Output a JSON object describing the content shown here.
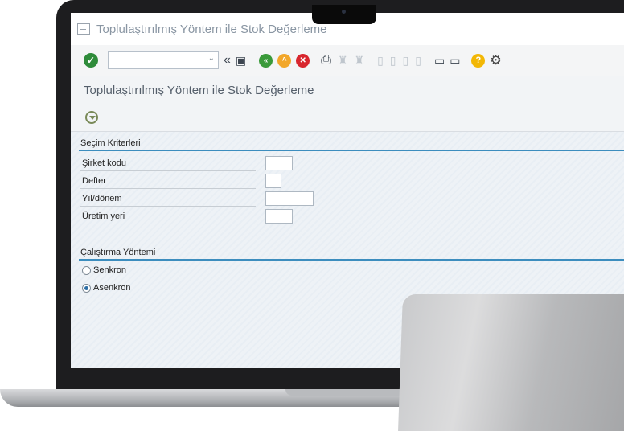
{
  "window": {
    "title": "Toplulaştırılmış Yöntem ile Stok Değerleme"
  },
  "toolbar": {
    "command_value": "",
    "icons": [
      "ok-icon",
      "back-icon",
      "save-icon",
      "green-back-icon",
      "exit-icon",
      "cancel-icon",
      "print-icon",
      "find-icon",
      "find-next-icon",
      "first-page-icon",
      "prev-page-icon",
      "next-page-icon",
      "last-page-icon",
      "create-session-icon",
      "shortcut-icon",
      "help-icon",
      "settings-icon"
    ]
  },
  "app": {
    "title": "Toplulaştırılmış Yöntem ile Stok Değerleme"
  },
  "selection": {
    "title": "Seçim Kriterleri",
    "fields": [
      {
        "label": "Şirket kodu",
        "value": ""
      },
      {
        "label": "Defter",
        "value": ""
      },
      {
        "label": "Yıl/dönem",
        "value": ""
      },
      {
        "label": "Üretim yeri",
        "value": ""
      }
    ]
  },
  "run_mode": {
    "title": "Çalıştırma Yöntemi",
    "options": [
      {
        "label": "Senkron",
        "selected": false
      },
      {
        "label": "Asenkron",
        "selected": true
      }
    ]
  },
  "colors": {
    "accent": "#3c8dbe",
    "ok_green": "#2e8b3a"
  }
}
